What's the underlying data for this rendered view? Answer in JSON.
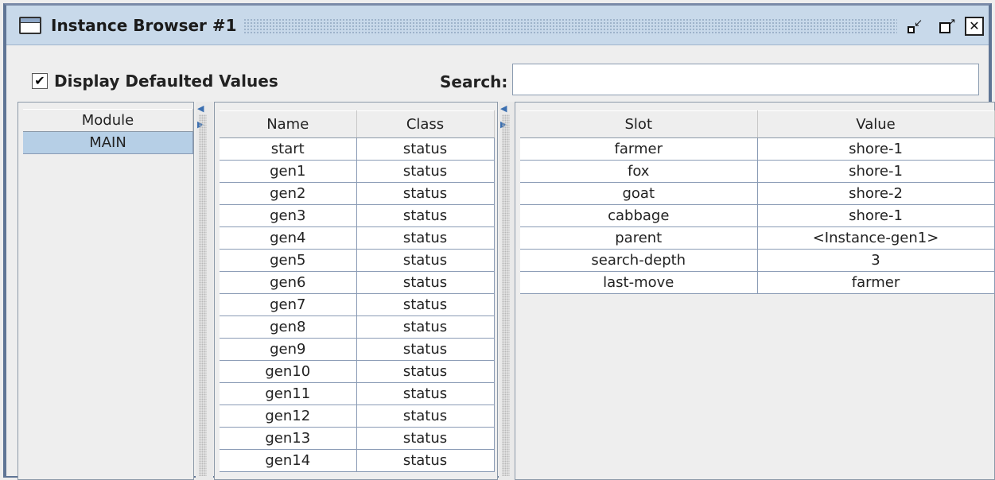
{
  "window": {
    "title": "Instance Browser #1"
  },
  "controls": {
    "checkbox_checked": true,
    "checkbox_mark": "✔",
    "checkbox_label": "Display Defaulted Values",
    "search_label": "Search:",
    "search_value": ""
  },
  "module_table": {
    "header": "Module",
    "rows": [
      "MAIN"
    ]
  },
  "instance_table": {
    "headers": [
      "Name",
      "Class"
    ],
    "rows": [
      [
        "start",
        "status"
      ],
      [
        "gen1",
        "status"
      ],
      [
        "gen2",
        "status"
      ],
      [
        "gen3",
        "status"
      ],
      [
        "gen4",
        "status"
      ],
      [
        "gen5",
        "status"
      ],
      [
        "gen6",
        "status"
      ],
      [
        "gen7",
        "status"
      ],
      [
        "gen8",
        "status"
      ],
      [
        "gen9",
        "status"
      ],
      [
        "gen10",
        "status"
      ],
      [
        "gen11",
        "status"
      ],
      [
        "gen12",
        "status"
      ],
      [
        "gen13",
        "status"
      ],
      [
        "gen14",
        "status"
      ]
    ]
  },
  "slot_table": {
    "headers": [
      "Slot",
      "Value"
    ],
    "rows": [
      [
        "farmer",
        "shore-1"
      ],
      [
        "fox",
        "shore-1"
      ],
      [
        "goat",
        "shore-2"
      ],
      [
        "cabbage",
        "shore-1"
      ],
      [
        "parent",
        "<Instance-gen1>"
      ],
      [
        "search-depth",
        "3"
      ],
      [
        "last-move",
        "farmer"
      ]
    ]
  },
  "icons": {
    "window_icon": "window-icon",
    "minimize": "minimize-icon",
    "maximize": "maximize-icon",
    "close": "close-icon",
    "close_glyph": "✕"
  },
  "colors": {
    "titlebar": "#c8d9ea",
    "selection": "#b6cfe6",
    "frame": "#5f7595"
  }
}
